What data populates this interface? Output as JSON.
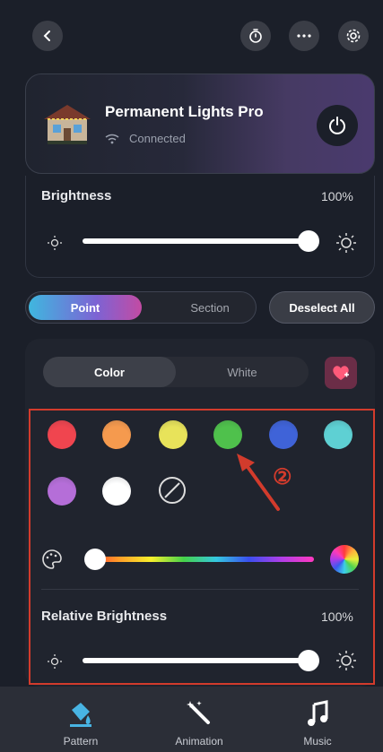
{
  "device": {
    "name": "Permanent Lights Pro",
    "status": "Connected"
  },
  "brightness": {
    "label": "Brightness",
    "value_text": "100%",
    "level": 1.0
  },
  "mode_toggle": {
    "point_label": "Point",
    "section_label": "Section",
    "selected": "Point"
  },
  "deselect_label": "Deselect All",
  "pattern_tabs": {
    "color_label": "Color",
    "white_label": "White",
    "selected": "Color"
  },
  "swatches": [
    {
      "name": "red",
      "color": "#f0454f"
    },
    {
      "name": "orange",
      "color": "#f59a4e"
    },
    {
      "name": "yellow",
      "color": "#e8e35a"
    },
    {
      "name": "green",
      "color": "#4fc14c"
    },
    {
      "name": "blue",
      "color": "#3f63d8"
    },
    {
      "name": "cyan",
      "color": "#5ed0d3"
    },
    {
      "name": "purple",
      "color": "#b56ed8"
    },
    {
      "name": "white",
      "color": "#ffffff"
    },
    {
      "name": "none",
      "color": "none"
    }
  ],
  "annotation": {
    "marker": "②",
    "color": "#d23b2c"
  },
  "relative_brightness": {
    "label": "Relative Brightness",
    "value_text": "100%",
    "level": 1.0
  },
  "color_slider": {
    "level": 0.0
  },
  "nav": [
    {
      "label": "Pattern",
      "icon": "paint-bucket-icon",
      "active": true
    },
    {
      "label": "Animation",
      "icon": "magic-wand-icon",
      "active": false
    },
    {
      "label": "Music",
      "icon": "music-note-icon",
      "active": false
    }
  ],
  "colors": {
    "accent": "#3fb7df",
    "background": "#1b1f29",
    "highlight_border": "#d23b2c"
  }
}
